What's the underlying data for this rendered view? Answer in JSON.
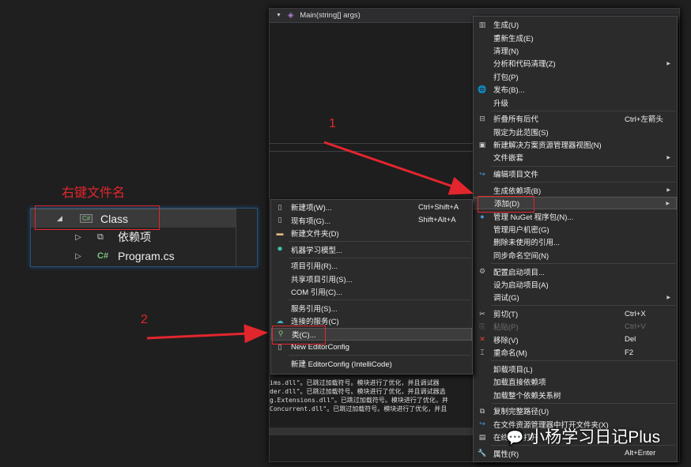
{
  "editor": {
    "method_dropdown": "Main(string[] args)",
    "output_lines": [
      "ims.dll\"。已跳过加载符号。模块进行了优化，并且调试器",
      "der.dll\"。已跳过加载符号。模块进行了优化，并且调试器选",
      "g.Extensions.dll\"。已跳过加载符号。模块进行了优化，并",
      "Concurrent.dll\"。已跳过加载符号。模块进行了优化，并且"
    ]
  },
  "solution_tree": {
    "items": [
      {
        "label": "Class",
        "icon": "csharp-project-icon"
      },
      {
        "label": "依赖项",
        "icon": "dependencies-icon"
      },
      {
        "label": "Program.cs",
        "icon": "csharp-file-icon"
      }
    ]
  },
  "annotations": {
    "right_click_label": "右键文件名",
    "step1": "1",
    "step2": "2"
  },
  "context_menu": {
    "items": [
      {
        "label": "生成(U)",
        "icon": "build-icon"
      },
      {
        "label": "重新生成(E)"
      },
      {
        "label": "清理(N)"
      },
      {
        "label": "分析和代码清理(Z)",
        "submenu": true
      },
      {
        "label": "打包(P)"
      },
      {
        "label": "发布(B)...",
        "icon": "publish-icon"
      },
      {
        "label": "升级"
      },
      {
        "sep": true
      },
      {
        "label": "折叠所有后代",
        "icon": "collapse-icon",
        "shortcut": "Ctrl+左箭头"
      },
      {
        "label": "限定为此范围(S)"
      },
      {
        "label": "新建解决方案资源管理器视图(N)",
        "icon": "new-view-icon"
      },
      {
        "label": "文件嵌套",
        "submenu": true
      },
      {
        "sep": true
      },
      {
        "label": "编辑项目文件",
        "icon": "edit-project-icon"
      },
      {
        "sep": true
      },
      {
        "label": "生成依赖项(B)",
        "submenu": true
      },
      {
        "label": "添加(D)",
        "submenu": true,
        "highlighted": true
      },
      {
        "label": "管理 NuGet 程序包(N)...",
        "icon": "nuget-icon"
      },
      {
        "label": "管理用户机密(G)"
      },
      {
        "label": "删除未使用的引用..."
      },
      {
        "label": "同步命名空间(N)"
      },
      {
        "sep": true
      },
      {
        "label": "配置启动项目...",
        "icon": "gear-icon"
      },
      {
        "label": "设为启动项目(A)"
      },
      {
        "label": "调试(G)",
        "submenu": true
      },
      {
        "sep": true
      },
      {
        "label": "剪切(T)",
        "icon": "cut-icon",
        "shortcut": "Ctrl+X"
      },
      {
        "label": "粘贴(P)",
        "icon": "paste-icon",
        "shortcut": "Ctrl+V",
        "disabled": true
      },
      {
        "label": "移除(V)",
        "icon": "remove-icon",
        "shortcut": "Del"
      },
      {
        "label": "重命名(M)",
        "icon": "rename-icon",
        "shortcut": "F2"
      },
      {
        "sep": true
      },
      {
        "label": "卸载项目(L)"
      },
      {
        "label": "加载直接依赖项"
      },
      {
        "label": "加载整个依赖关系树"
      },
      {
        "sep": true
      },
      {
        "label": "复制完整路径(U)",
        "icon": "copy-icon"
      },
      {
        "label": "在文件资源管理器中打开文件夹(X)",
        "icon": "open-folder-icon"
      },
      {
        "label": "在终端中打开",
        "icon": "terminal-icon"
      },
      {
        "sep": true
      },
      {
        "label": "属性(R)",
        "icon": "wrench-icon",
        "shortcut": "Alt+Enter"
      }
    ]
  },
  "add_submenu": {
    "items": [
      {
        "label": "新建项(W)...",
        "icon": "new-item-icon",
        "shortcut": "Ctrl+Shift+A"
      },
      {
        "label": "现有项(G)...",
        "icon": "existing-item-icon",
        "shortcut": "Shift+Alt+A"
      },
      {
        "label": "新建文件夹(D)",
        "icon": "new-folder-icon"
      },
      {
        "sep": true
      },
      {
        "label": "机器学习模型...",
        "icon": "ml-model-icon"
      },
      {
        "sep": true
      },
      {
        "label": "项目引用(R)..."
      },
      {
        "label": "共享项目引用(S)..."
      },
      {
        "label": "COM 引用(C)..."
      },
      {
        "sep": true
      },
      {
        "label": "服务引用(S)..."
      },
      {
        "label": "连接的服务(C)",
        "icon": "connected-service-icon"
      },
      {
        "label": "类(C)...",
        "icon": "add-class-icon",
        "highlighted": true
      },
      {
        "label": "New EditorConfig",
        "icon": "file-icon"
      },
      {
        "sep": true
      },
      {
        "label": "新建 EditorConfig (IntelliCode)"
      }
    ]
  },
  "watermark": "小杨学习日记Plus",
  "colors": {
    "annotation": "#e3262d",
    "menu_bg": "#2b2b2b",
    "highlight": "#3d3d3d"
  }
}
